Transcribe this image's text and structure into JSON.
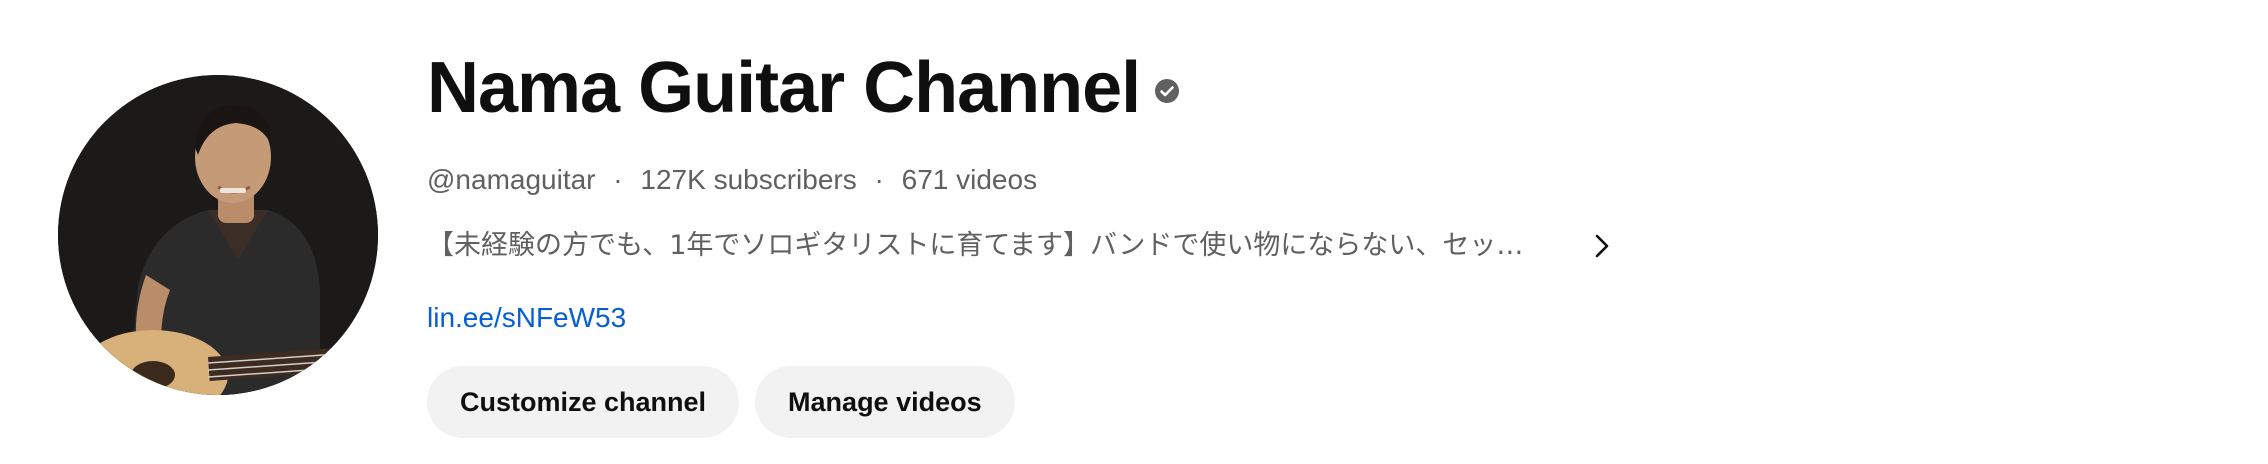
{
  "channel": {
    "title": "Nama Guitar Channel",
    "verified_icon": "verified-check-icon",
    "handle": "@namaguitar",
    "subscribers": "127K subscribers",
    "videos": "671 videos",
    "separator": "·",
    "description": "【未経験の方でも、1年でソロギタリストに育てます】バンドで使い物にならない、セッション",
    "description_more_icon": "chevron-right-icon",
    "link": "lin.ee/sNFeW53"
  },
  "buttons": {
    "customize": "Customize channel",
    "manage": "Manage videos"
  },
  "colors": {
    "title": "#0f0f0f",
    "secondary_text": "#606060",
    "link": "#065fd4",
    "button_bg": "#f2f2f2",
    "avatar_bg": "#1a1a1a"
  }
}
